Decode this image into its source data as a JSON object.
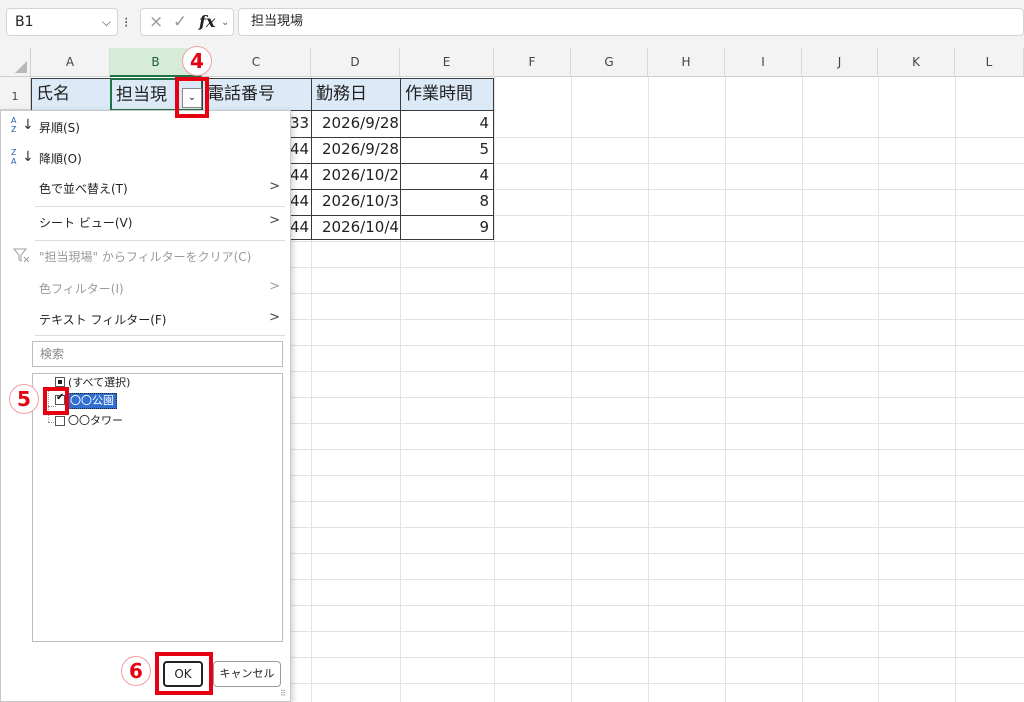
{
  "formula_bar": {
    "name_box": "B1",
    "cancel_icon": "×",
    "enter_icon": "✓",
    "fx_label": "fx",
    "content": "担当現場"
  },
  "columns": [
    "A",
    "B",
    "C",
    "D",
    "E",
    "F",
    "G",
    "H",
    "I",
    "J",
    "K",
    "L"
  ],
  "rows": [
    "1"
  ],
  "header_row": {
    "A": "氏名",
    "B": "担当現",
    "C": "電話番号",
    "D": "勤務日",
    "E": "作業時間"
  },
  "data_rows": [
    {
      "C_tail": "33",
      "D": "2026/9/28",
      "E": "4"
    },
    {
      "C_tail": "44",
      "D": "2026/9/28",
      "E": "5"
    },
    {
      "C_tail": "44",
      "D": "2026/10/2",
      "E": "4"
    },
    {
      "C_tail": "44",
      "D": "2026/10/3",
      "E": "8"
    },
    {
      "C_tail": "44",
      "D": "2026/10/4",
      "E": "9"
    }
  ],
  "filter_menu": {
    "sort_asc": "昇順(S)",
    "sort_desc": "降順(O)",
    "sort_by_color": "色で並べ替え(T)",
    "sheet_view": "シート ビュー(V)",
    "clear_filter": "\"担当現場\" からフィルターをクリア(C)",
    "color_filter": "色フィルター(I)",
    "text_filter": "テキスト フィルター(F)",
    "search_placeholder": "検索",
    "list_items": [
      {
        "label": "(すべて選択)",
        "state": "partial"
      },
      {
        "label": "〇〇公園",
        "state": "checked"
      },
      {
        "label": "〇〇タワー",
        "state": "unchecked"
      }
    ],
    "ok_label": "OK",
    "cancel_label": "キャンセル"
  },
  "annotations": {
    "step4": "4",
    "step5": "5",
    "step6": "6",
    "accent_color": "#e60012"
  }
}
